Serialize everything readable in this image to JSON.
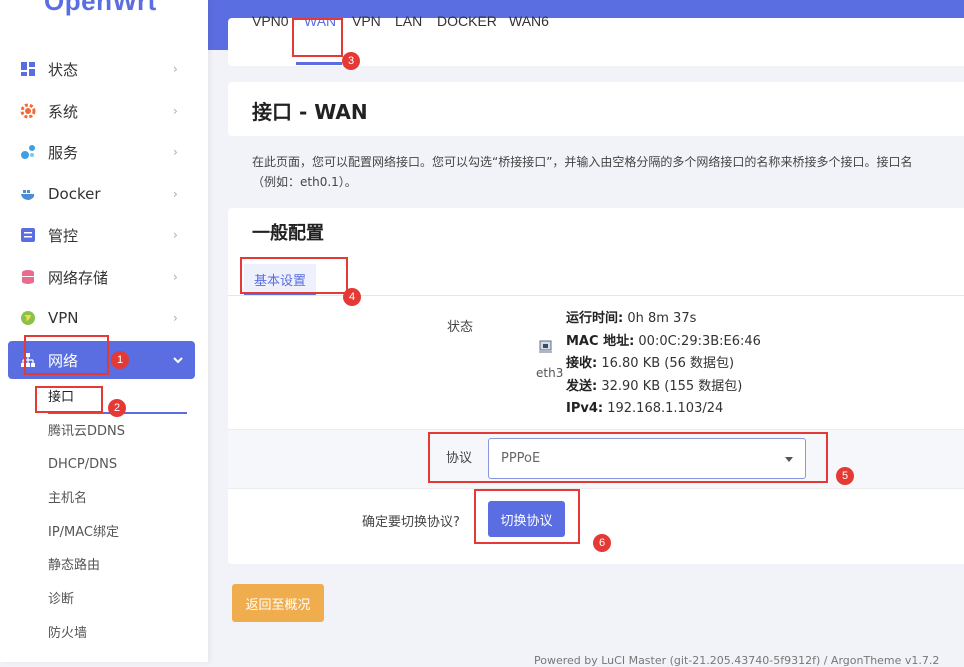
{
  "brand": {
    "logo": "OpenWrt"
  },
  "sidebar": {
    "items": [
      {
        "label": "状态",
        "icon": "dashboard-icon",
        "color": "#5b6ee1"
      },
      {
        "label": "系统",
        "icon": "gear-icon",
        "color": "#ef6c39"
      },
      {
        "label": "服务",
        "icon": "puzzle-icon",
        "color": "#3fa0e0"
      },
      {
        "label": "Docker",
        "icon": "docker-icon",
        "color": "#4a8fd6"
      },
      {
        "label": "管控",
        "icon": "sliders-icon",
        "color": "#5b6ee1"
      },
      {
        "label": "网络存储",
        "icon": "database-icon",
        "color": "#e96b8e"
      },
      {
        "label": "VPN",
        "icon": "globe-icon",
        "color": "#8bc34a"
      },
      {
        "label": "网络",
        "icon": "network-icon",
        "color": "#ffffff"
      }
    ],
    "submenu": [
      "接口",
      "腾讯云DDNS",
      "DHCP/DNS",
      "主机名",
      "IP/MAC绑定",
      "静态路由",
      "诊断",
      "防火墙"
    ]
  },
  "tabs": [
    "VPN0",
    "WAN",
    "VPN",
    "LAN",
    "DOCKER",
    "WAN6"
  ],
  "page": {
    "title": "接口 - WAN",
    "description_line1": "在此页面，您可以配置网络接口。您可以勾选“桥接接口”，并输入由空格分隔的多个网络接口的名称来桥接多个接口。接口名",
    "description_line2": "（例如：eth0.1）。"
  },
  "general": {
    "title": "一般配置",
    "subtab": "基本设置",
    "status_label": "状态",
    "device": "eth3",
    "status": {
      "uptime_key": "运行时间:",
      "uptime_val": "0h 8m 37s",
      "mac_key": "MAC 地址:",
      "mac_val": "00:0C:29:3B:E6:46",
      "rx_key": "接收:",
      "rx_val": "16.80 KB (56 数据包)",
      "tx_key": "发送:",
      "tx_val": "32.90 KB (155 数据包)",
      "ipv4_key": "IPv4:",
      "ipv4_val": "192.168.1.103/24"
    },
    "protocol_label": "协议",
    "protocol_value": "PPPoE",
    "switch_question": "确定要切换协议?",
    "switch_button": "切换协议"
  },
  "actions": {
    "back": "返回至概况"
  },
  "footer": "Powered by LuCI Master (git-21.205.43740-5f9312f) / ArgonTheme v1.7.2",
  "annotations": [
    "1",
    "2",
    "3",
    "4",
    "5",
    "6"
  ],
  "colors": {
    "accent": "#5b6ee1",
    "annotation": "#e53935",
    "back_button": "#f0ad4e"
  }
}
